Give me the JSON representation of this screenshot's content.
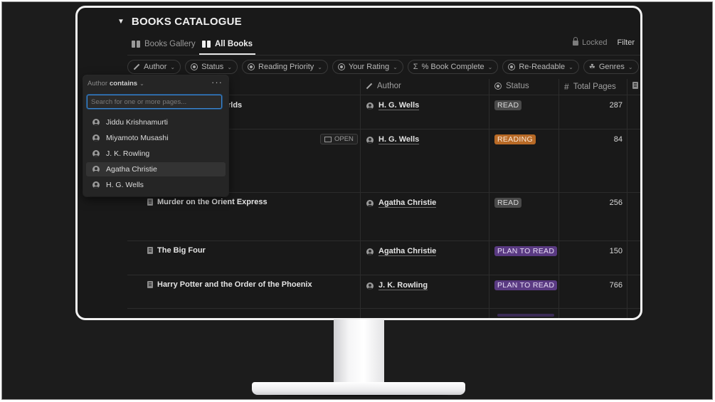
{
  "database": {
    "title": "BOOKS CATALOGUE"
  },
  "views": {
    "tabs": [
      {
        "label": "Books Gallery",
        "active": false
      },
      {
        "label": "All Books",
        "active": true
      }
    ],
    "locked_label": "Locked",
    "filter_label": "Filter"
  },
  "filters": [
    {
      "label": "Author",
      "icon": "pen-icon"
    },
    {
      "label": "Status",
      "icon": "status-icon"
    },
    {
      "label": "Reading Priority",
      "icon": "status-icon"
    },
    {
      "label": "Your Rating",
      "icon": "status-icon"
    },
    {
      "label": "% Book Complete",
      "icon": "sigma-icon"
    },
    {
      "label": "Re-Readable",
      "icon": "status-icon"
    },
    {
      "label": "Genres",
      "icon": "multi-select-icon"
    }
  ],
  "columns": {
    "author": "Author",
    "status": "Status",
    "total_pages": "Total Pages"
  },
  "rows": [
    {
      "title_fragment": "rlds",
      "author": "H. G. Wells",
      "status": "READ",
      "pages": "287"
    },
    {
      "open_label": "OPEN",
      "author": "H. G. Wells",
      "status": "READING",
      "pages": "84"
    },
    {
      "title": "Murder on the Orient Express",
      "author": "Agatha Christie",
      "status": "READ",
      "pages": "256"
    },
    {
      "title": "The Big Four",
      "author": "Agatha Christie",
      "status": "PLAN TO READ",
      "pages": "150"
    },
    {
      "title": "Harry Potter and the Order of the Phoenix",
      "author": "J. K. Rowling",
      "status": "PLAN TO READ",
      "pages": "766"
    }
  ],
  "status_colors": {
    "READ": "#4a4a4a",
    "READING": "#b86a26",
    "PLAN TO READ": "#5a3a82"
  },
  "author_filter": {
    "property": "Author",
    "operator": "contains",
    "search_placeholder": "Search for one or more pages...",
    "options": [
      {
        "label": "Jiddu Krishnamurti"
      },
      {
        "label": "Miyamoto Musashi"
      },
      {
        "label": "J. K. Rowling"
      },
      {
        "label": "Agatha Christie",
        "hovered": true
      },
      {
        "label": "H. G. Wells"
      }
    ]
  }
}
